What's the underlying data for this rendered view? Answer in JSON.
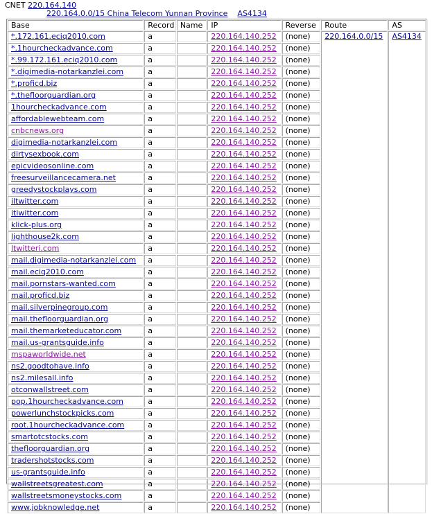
{
  "header": {
    "prefix": "CNET",
    "ip": "220.164.140",
    "network": "220.164.0.0/15 China Telecom Yunnan Province",
    "asn": "AS4134"
  },
  "columns": [
    "Base",
    "Record",
    "Name",
    "IP",
    "Reverse",
    "Route",
    "AS"
  ],
  "route": "220.164.0.0/15",
  "as": "AS4134",
  "rows": [
    {
      "base": "*.172.161.eciq2010.com",
      "record": "a",
      "name": "",
      "ip": "220.164.140.252",
      "reverse": "(none)",
      "visited": false
    },
    {
      "base": "*.1hourcheckadvance.com",
      "record": "a",
      "name": "",
      "ip": "220.164.140.252",
      "reverse": "(none)",
      "visited": false
    },
    {
      "base": "*.99.172.161.eciq2010.com",
      "record": "a",
      "name": "",
      "ip": "220.164.140.252",
      "reverse": "(none)",
      "visited": false
    },
    {
      "base": "*.digimedia-notarkanzlei.com",
      "record": "a",
      "name": "",
      "ip": "220.164.140.252",
      "reverse": "(none)",
      "visited": false
    },
    {
      "base": "*.proficd.biz",
      "record": "a",
      "name": "",
      "ip": "220.164.140.252",
      "reverse": "(none)",
      "visited": false
    },
    {
      "base": "*.thefloorguardian.org",
      "record": "a",
      "name": "",
      "ip": "220.164.140.252",
      "reverse": "(none)",
      "visited": false
    },
    {
      "base": "1hourcheckadvance.com",
      "record": "a",
      "name": "",
      "ip": "220.164.140.252",
      "reverse": "(none)",
      "visited": false
    },
    {
      "base": "affordablewebteam.com",
      "record": "a",
      "name": "",
      "ip": "220.164.140.252",
      "reverse": "(none)",
      "visited": false
    },
    {
      "base": "cnbcnews.org",
      "record": "a",
      "name": "",
      "ip": "220.164.140.252",
      "reverse": "(none)",
      "visited": true
    },
    {
      "base": "digimedia-notarkanzlei.com",
      "record": "a",
      "name": "",
      "ip": "220.164.140.252",
      "reverse": "(none)",
      "visited": false
    },
    {
      "base": "dirtysexbook.com",
      "record": "a",
      "name": "",
      "ip": "220.164.140.252",
      "reverse": "(none)",
      "visited": false
    },
    {
      "base": "epicvideosonline.com",
      "record": "a",
      "name": "",
      "ip": "220.164.140.252",
      "reverse": "(none)",
      "visited": false
    },
    {
      "base": "freesurveillancecamera.net",
      "record": "a",
      "name": "",
      "ip": "220.164.140.252",
      "reverse": "(none)",
      "visited": false
    },
    {
      "base": "greedystockplays.com",
      "record": "a",
      "name": "",
      "ip": "220.164.140.252",
      "reverse": "(none)",
      "visited": false
    },
    {
      "base": "iltwitter.com",
      "record": "a",
      "name": "",
      "ip": "220.164.140.252",
      "reverse": "(none)",
      "visited": false
    },
    {
      "base": "itiwitter.com",
      "record": "a",
      "name": "",
      "ip": "220.164.140.252",
      "reverse": "(none)",
      "visited": false
    },
    {
      "base": "klick-plus.org",
      "record": "a",
      "name": "",
      "ip": "220.164.140.252",
      "reverse": "(none)",
      "visited": false
    },
    {
      "base": "lighthouse2k.com",
      "record": "a",
      "name": "",
      "ip": "220.164.140.252",
      "reverse": "(none)",
      "visited": false
    },
    {
      "base": "ltwitteri.com",
      "record": "a",
      "name": "",
      "ip": "220.164.140.252",
      "reverse": "(none)",
      "visited": true
    },
    {
      "base": "mail.digimedia-notarkanzlei.com",
      "record": "a",
      "name": "",
      "ip": "220.164.140.252",
      "reverse": "(none)",
      "visited": false
    },
    {
      "base": "mail.eciq2010.com",
      "record": "a",
      "name": "",
      "ip": "220.164.140.252",
      "reverse": "(none)",
      "visited": false
    },
    {
      "base": "mail.pornstars-wanted.com",
      "record": "a",
      "name": "",
      "ip": "220.164.140.252",
      "reverse": "(none)",
      "visited": false
    },
    {
      "base": "mail.proficd.biz",
      "record": "a",
      "name": "",
      "ip": "220.164.140.252",
      "reverse": "(none)",
      "visited": false
    },
    {
      "base": "mail.silverpinegroup.com",
      "record": "a",
      "name": "",
      "ip": "220.164.140.252",
      "reverse": "(none)",
      "visited": false
    },
    {
      "base": "mail.thefloorguardian.org",
      "record": "a",
      "name": "",
      "ip": "220.164.140.252",
      "reverse": "(none)",
      "visited": false
    },
    {
      "base": "mail.themarketeducator.com",
      "record": "a",
      "name": "",
      "ip": "220.164.140.252",
      "reverse": "(none)",
      "visited": false
    },
    {
      "base": "mail.us-grantsguide.info",
      "record": "a",
      "name": "",
      "ip": "220.164.140.252",
      "reverse": "(none)",
      "visited": false
    },
    {
      "base": "mspaworldwide.net",
      "record": "a",
      "name": "",
      "ip": "220.164.140.252",
      "reverse": "(none)",
      "visited": true
    },
    {
      "base": "ns2.goodtohave.info",
      "record": "a",
      "name": "",
      "ip": "220.164.140.252",
      "reverse": "(none)",
      "visited": false
    },
    {
      "base": "ns2.milesall.info",
      "record": "a",
      "name": "",
      "ip": "220.164.140.252",
      "reverse": "(none)",
      "visited": false
    },
    {
      "base": "otconwallstreet.com",
      "record": "a",
      "name": "",
      "ip": "220.164.140.252",
      "reverse": "(none)",
      "visited": false
    },
    {
      "base": "pop.1hourcheckadvance.com",
      "record": "a",
      "name": "",
      "ip": "220.164.140.252",
      "reverse": "(none)",
      "visited": false
    },
    {
      "base": "powerlunchstockpicks.com",
      "record": "a",
      "name": "",
      "ip": "220.164.140.252",
      "reverse": "(none)",
      "visited": false
    },
    {
      "base": "root.1hourcheckadvance.com",
      "record": "a",
      "name": "",
      "ip": "220.164.140.252",
      "reverse": "(none)",
      "visited": false
    },
    {
      "base": "smartotcstocks.com",
      "record": "a",
      "name": "",
      "ip": "220.164.140.252",
      "reverse": "(none)",
      "visited": false
    },
    {
      "base": "thefloorguardian.org",
      "record": "a",
      "name": "",
      "ip": "220.164.140.252",
      "reverse": "(none)",
      "visited": false
    },
    {
      "base": "tradershotstocks.com",
      "record": "a",
      "name": "",
      "ip": "220.164.140.252",
      "reverse": "(none)",
      "visited": false
    },
    {
      "base": "us-grantsguide.info",
      "record": "a",
      "name": "",
      "ip": "220.164.140.252",
      "reverse": "(none)",
      "visited": false
    },
    {
      "base": "wallstreetsgreatest.com",
      "record": "a",
      "name": "",
      "ip": "220.164.140.252",
      "reverse": "(none)",
      "visited": false
    },
    {
      "base": "wallstreetsmoneystocks.com",
      "record": "a",
      "name": "",
      "ip": "220.164.140.252",
      "reverse": "(none)",
      "visited": false
    },
    {
      "base": "www.jobknowledge.net",
      "record": "a",
      "name": "",
      "ip": "220.164.140.252",
      "reverse": "(none)",
      "visited": false
    }
  ],
  "colors": {
    "link": "#0a0a99",
    "visited_link": "#8a1aa0",
    "border": "#a8a8a8"
  }
}
